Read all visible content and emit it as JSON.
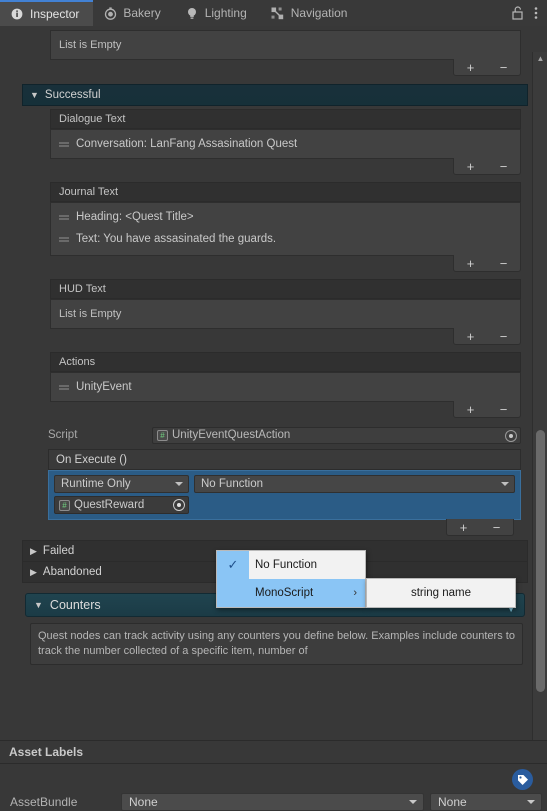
{
  "window": {
    "tabs": [
      {
        "label": "Inspector",
        "icon": "info-circle-icon",
        "active": true
      },
      {
        "label": "Bakery",
        "icon": "stopwatch-icon",
        "active": false
      },
      {
        "label": "Lighting",
        "icon": "lightbulb-icon",
        "active": false
      },
      {
        "label": "Navigation",
        "icon": "navigation-mesh-icon",
        "active": false
      }
    ],
    "lock_icon": "lock-open-icon",
    "menu_icon": "kebab-menu-icon"
  },
  "sections": {
    "top_list": {
      "empty_text": "List is Empty",
      "add_label": "+",
      "remove_label": "−"
    },
    "successful": {
      "title": "Successful",
      "foldout": "▼",
      "dialogue": {
        "header": "Dialogue Text",
        "items": [
          "Conversation: LanFang Assasination Quest"
        ]
      },
      "journal": {
        "header": "Journal Text",
        "items": [
          "Heading: <Quest Title>",
          "Text: You have assasinated the guards."
        ]
      },
      "hud": {
        "header": "HUD Text",
        "empty_text": "List is Empty"
      },
      "actions": {
        "header": "Actions",
        "items": [
          "UnityEvent"
        ],
        "script_label": "Script",
        "script_value": "UnityEventQuestAction",
        "on_execute_label": "On Execute ()",
        "entry": {
          "runtime_mode": "Runtime Only",
          "function": "No Function",
          "object_ref": "QuestReward"
        }
      }
    },
    "failed": {
      "title": "Failed",
      "foldout": "▶"
    },
    "abandoned": {
      "title": "Abandoned",
      "foldout": "▶"
    },
    "counters": {
      "title": "Counters",
      "foldout": "▼",
      "help_text": "Quest nodes can track activity using any counters you define below. Examples include counters to track the number collected of a specific item, number of"
    }
  },
  "popup_menu": {
    "items": [
      {
        "label": "No Function",
        "checked": true,
        "has_submenu": false,
        "highlighted": false
      },
      {
        "label": "MonoScript",
        "checked": false,
        "has_submenu": true,
        "highlighted": true
      }
    ],
    "submenu": {
      "items": [
        "string name"
      ]
    },
    "submenu_arrow": "›",
    "check_glyph": "✓"
  },
  "footer": {
    "title": "Asset Labels",
    "tag_icon": "tag-icon",
    "assetbundle_label": "AssetBundle",
    "assetbundle_value": "None",
    "variant_value": "None"
  },
  "colors": {
    "accent_blue": "#4281d4",
    "selection_blue": "#2b5c86",
    "teal_header": "#1b3b46",
    "popup_highlight": "#8ac5f5",
    "panel_bg": "#383838"
  }
}
